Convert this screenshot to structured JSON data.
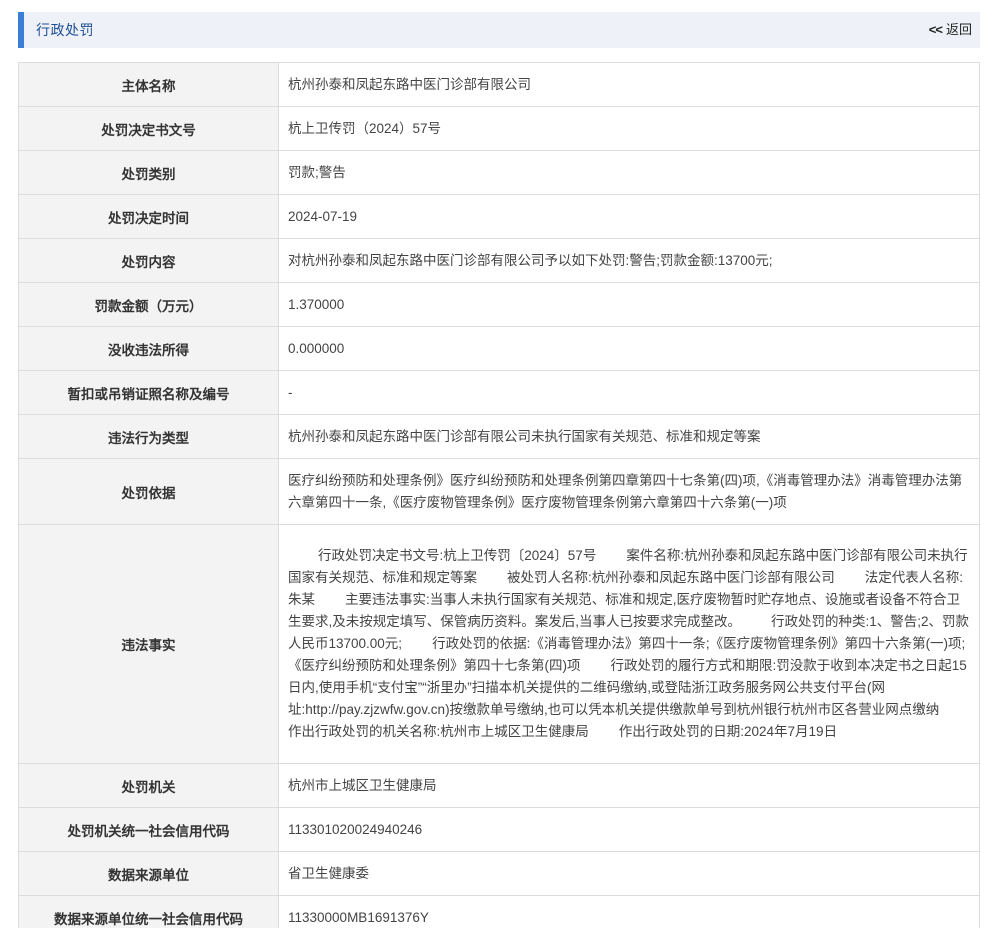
{
  "header": {
    "title": "行政处罚",
    "back_arrows": "<<",
    "back_label": "返回"
  },
  "fields": [
    {
      "label": "主体名称",
      "value": "杭州孙泰和凤起东路中医门诊部有限公司"
    },
    {
      "label": "处罚决定书文号",
      "value": "杭上卫传罚（2024）57号"
    },
    {
      "label": "处罚类别",
      "value": "罚款;警告"
    },
    {
      "label": "处罚决定时间",
      "value": "2024-07-19"
    },
    {
      "label": "处罚内容",
      "value": "对杭州孙泰和凤起东路中医门诊部有限公司予以如下处罚:警告;罚款金额:13700元;"
    },
    {
      "label": "罚款金额（万元）",
      "value": "1.370000"
    },
    {
      "label": "没收违法所得",
      "value": "0.000000"
    },
    {
      "label": "暂扣或吊销证照名称及编号",
      "value": "-"
    },
    {
      "label": "违法行为类型",
      "value": "杭州孙泰和凤起东路中医门诊部有限公司未执行国家有关规范、标准和规定等案"
    },
    {
      "label": "处罚依据",
      "value": "医疗纠纷预防和处理条例》医疗纠纷预防和处理条例第四章第四十七条第(四)项,《消毒管理办法》消毒管理办法第六章第四十一条,《医疗废物管理条例》医疗废物管理条例第六章第四十六条第(一)项"
    },
    {
      "label": "违法事实",
      "value": "        行政处罚决定书文号:杭上卫传罚〔2024〕57号        案件名称:杭州孙泰和凤起东路中医门诊部有限公司未执行国家有关规范、标准和规定等案        被处罚人名称:杭州孙泰和凤起东路中医门诊部有限公司        法定代表人名称:朱某        主要违法事实:当事人未执行国家有关规范、标准和规定,医疗废物暂时贮存地点、设施或者设备不符合卫生要求,及未按规定填写、保管病历资料。案发后,当事人已按要求完成整改。        行政处罚的种类:1、警告;2、罚款人民币13700.00元;        行政处罚的依据:《消毒管理办法》第四十一条;《医疗废物管理条例》第四十六条第(一)项;《医疗纠纷预防和处理条例》第四十七条第(四)项        行政处罚的履行方式和期限:罚没款于收到本决定书之日起15日内,使用手机“支付宝”“浙里办”扫描本机关提供的二维码缴纳,或登陆浙江政务服务网公共支付平台(网址:http://pay.zjzwfw.gov.cn)按缴款单号缴纳,也可以凭本机关提供缴款单号到杭州银行杭州市区各营业网点缴纳        作出行政处罚的机关名称:杭州市上城区卫生健康局        作出行政处罚的日期:2024年7月19日"
    },
    {
      "label": "处罚机关",
      "value": "杭州市上城区卫生健康局"
    },
    {
      "label": "处罚机关统一社会信用代码",
      "value": "113301020024940246"
    },
    {
      "label": "数据来源单位",
      "value": "省卫生健康委"
    },
    {
      "label": "数据来源单位统一社会信用代码",
      "value": "11330000MB1691376Y"
    }
  ]
}
